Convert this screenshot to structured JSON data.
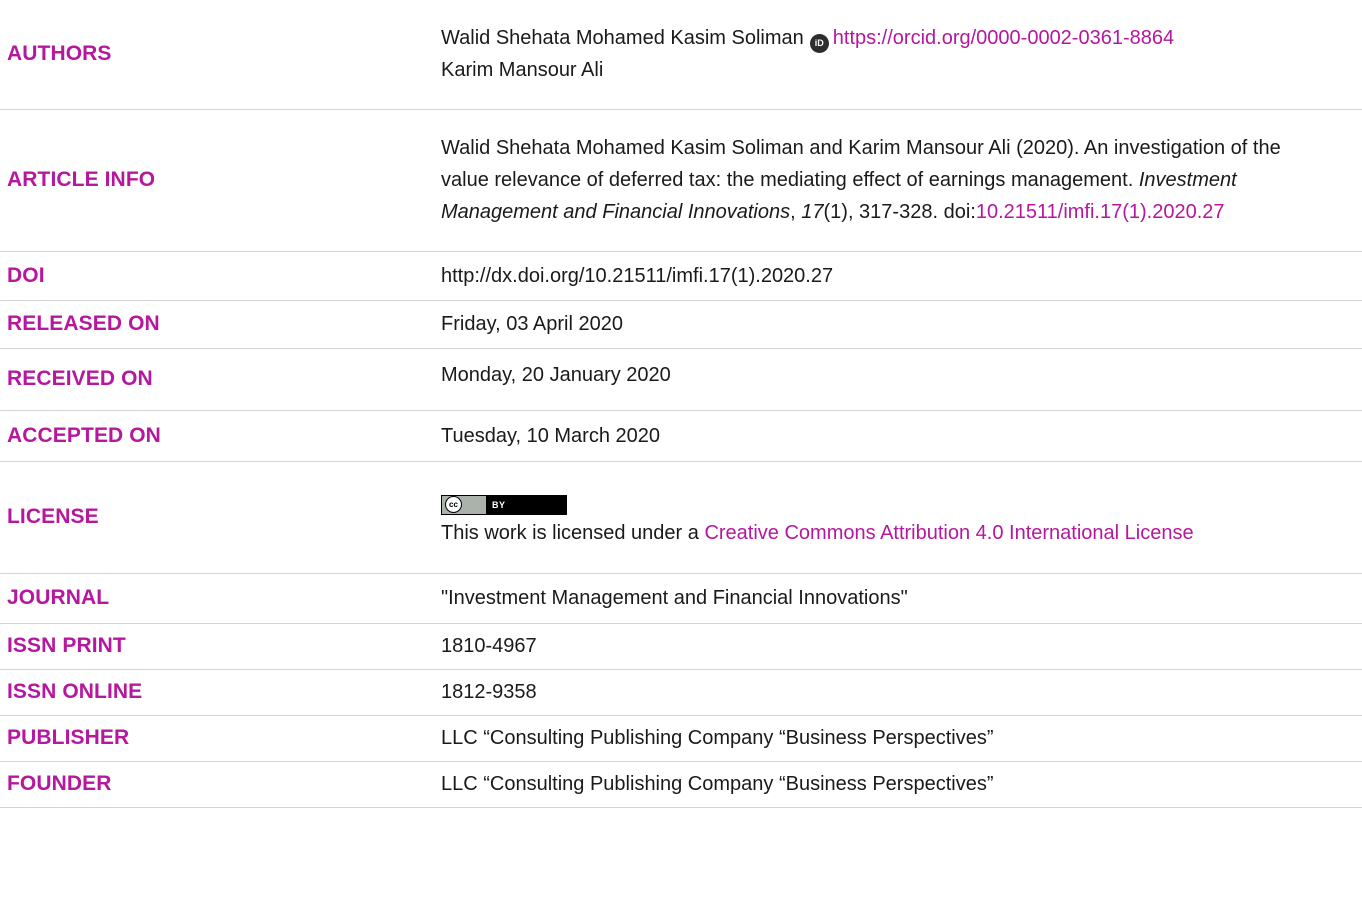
{
  "rows": {
    "authors": {
      "label": "AUTHORS",
      "author1_name": "Walid Shehata Mohamed Kasim Soliman",
      "author1_orcid": "https://orcid.org/0000-0002-0361-8864",
      "author2_name": "Karim Mansour Ali",
      "orcid_icon_text": "iD"
    },
    "article_info": {
      "label": "ARTICLE INFO",
      "citation_text": "Walid Shehata Mohamed Kasim Soliman and Karim Mansour Ali (2020). An investigation of the value relevance of deferred tax: the mediating effect of earnings management. ",
      "journal_italic": "Investment Management and Financial Innovations",
      "after_journal": ", ",
      "volume_italic": "17",
      "after_volume": "(1), 317-328. doi:",
      "doi_link": "10.21511/imfi.17(1).2020.27"
    },
    "doi": {
      "label": "DOI",
      "value": "http://dx.doi.org/10.21511/imfi.17(1).2020.27"
    },
    "released_on": {
      "label": "RELEASED ON",
      "value": "Friday, 03 April 2020"
    },
    "received_on": {
      "label": "RECEIVED ON",
      "value": "Monday, 20 January 2020"
    },
    "accepted_on": {
      "label": "ACCEPTED ON",
      "value": "Tuesday, 10 March 2020"
    },
    "license": {
      "label": "LICENSE",
      "badge_cc": "cc",
      "badge_by": "BY",
      "text_prefix": "This work is licensed under a ",
      "link_text": "Creative Commons Attribution 4.0 International License"
    },
    "journal": {
      "label": "JOURNAL",
      "value": "\"Investment Management and Financial Innovations\""
    },
    "issn_print": {
      "label": "ISSN PRINT",
      "value": "1810-4967"
    },
    "issn_online": {
      "label": "ISSN ONLINE",
      "value": "1812-9358"
    },
    "publisher": {
      "label": "PUBLISHER",
      "value": "LLC “Consulting Publishing Company “Business Perspectives”"
    },
    "founder": {
      "label": "FOUNDER",
      "value": "LLC “Consulting Publishing Company “Business Perspectives”"
    }
  },
  "colors": {
    "accent": "#b5179e",
    "text": "#1a1a1a",
    "rule": "#d4d4d4"
  }
}
